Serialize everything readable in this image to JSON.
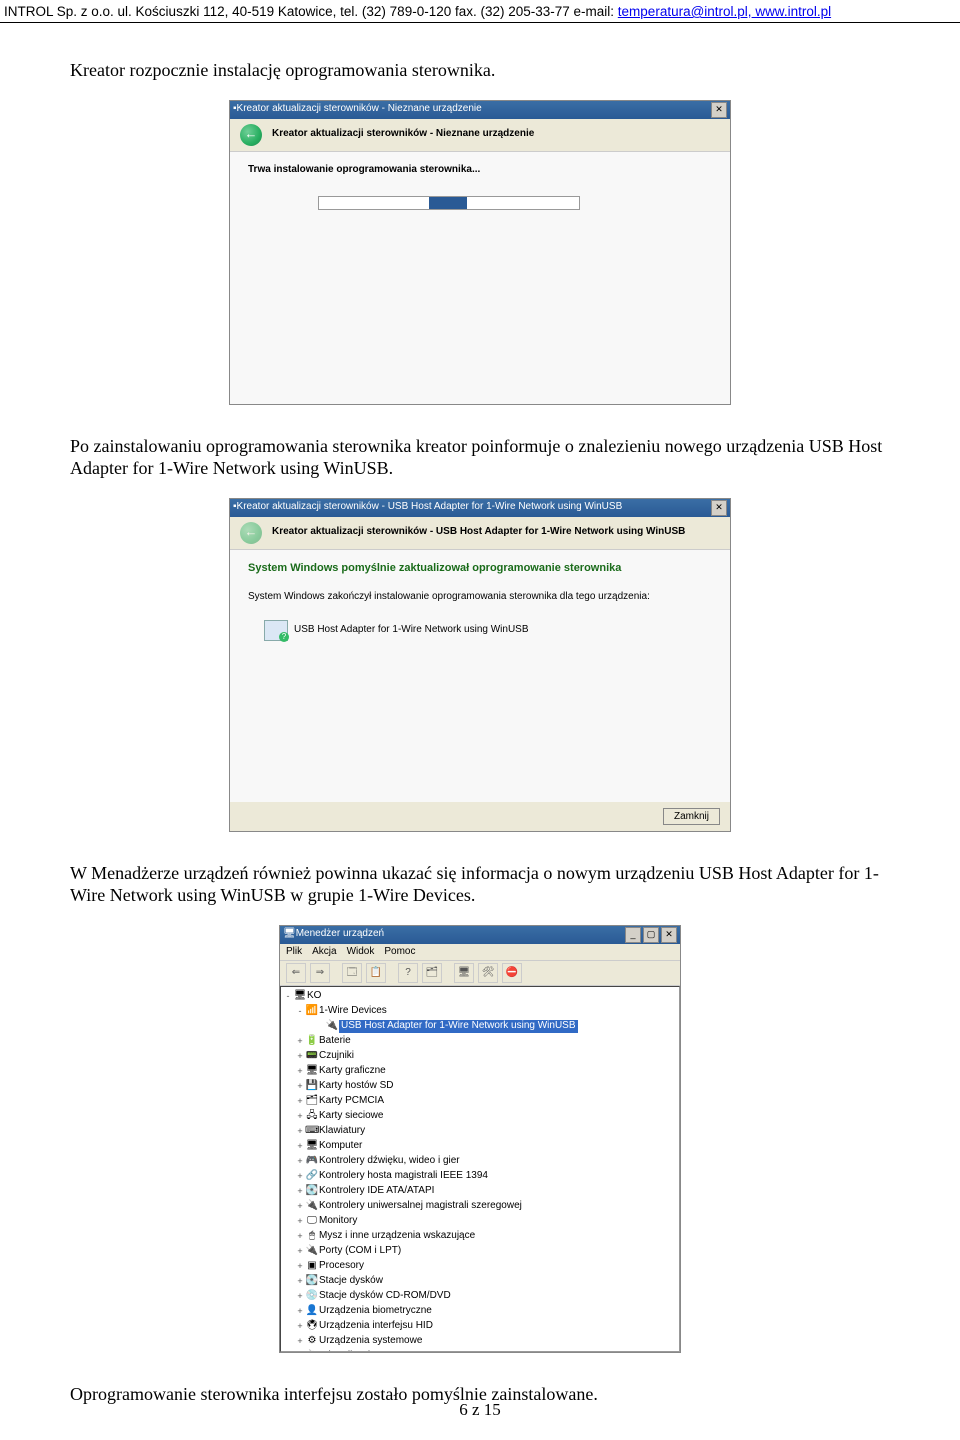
{
  "header": {
    "text_prefix": "INTROL Sp. z o.o. ul. Kościuszki 112, 40-519 Katowice, tel. (32) 789-0-120 fax. (32) 205-33-77 e-mail: ",
    "email": "temperatura@introl.pl,",
    "url": " www.introl.pl"
  },
  "p1": "Kreator rozpocznie instalację oprogramowania sterownika.",
  "shot1": {
    "title": "Kreator aktualizacji sterowników - Nieznane urządzenie",
    "subtitle": "Kreator aktualizacji sterowników - Nieznane urządzenie",
    "msg": "Trwa instalowanie oprogramowania sterownika..."
  },
  "p2": "Po zainstalowaniu oprogramowania sterownika kreator poinformuje o znalezieniu nowego urządzenia USB Host Adapter for 1-Wire Network using WinUSB.",
  "shot2": {
    "title": "Kreator aktualizacji sterowników - USB Host Adapter for 1-Wire Network using WinUSB",
    "subtitle": "Kreator aktualizacji sterowników - USB Host Adapter for 1-Wire Network using WinUSB",
    "h": "System Windows pomyślnie zaktualizował oprogramowanie sterownika",
    "msg": "System Windows zakończył instalowanie oprogramowania sterownika dla tego urządzenia:",
    "dev": "USB Host Adapter for 1-Wire Network using WinUSB",
    "close": "Zamknij"
  },
  "p3": "W Menadżerze urządzeń również powinna ukazać się informacja o nowym urządzeniu USB Host Adapter for 1-Wire Network using WinUSB w grupie 1-Wire Devices.",
  "shot3": {
    "title": "Menedżer urządzeń",
    "menu": [
      "Plik",
      "Akcja",
      "Widok",
      "Pomoc"
    ],
    "root": "KO",
    "items": [
      {
        "l": "1-Wire Devices",
        "exp": "-",
        "ic": "📶"
      },
      {
        "l": "USB Host Adapter for 1-Wire Network using WinUSB",
        "sel": true,
        "indent": 1,
        "ic": "🔌"
      },
      {
        "l": "Baterie",
        "exp": "+",
        "ic": "🔋"
      },
      {
        "l": "Czujniki",
        "exp": "+",
        "ic": "📟"
      },
      {
        "l": "Karty graficzne",
        "exp": "+",
        "ic": "🖥"
      },
      {
        "l": "Karty hostów SD",
        "exp": "+",
        "ic": "💾"
      },
      {
        "l": "Karty PCMCIA",
        "exp": "+",
        "ic": "🗂"
      },
      {
        "l": "Karty sieciowe",
        "exp": "+",
        "ic": "🖧"
      },
      {
        "l": "Klawiatury",
        "exp": "+",
        "ic": "⌨"
      },
      {
        "l": "Komputer",
        "exp": "+",
        "ic": "🖥"
      },
      {
        "l": "Kontrolery dźwięku, wideo i gier",
        "exp": "+",
        "ic": "🎮"
      },
      {
        "l": "Kontrolery hosta magistrali IEEE 1394",
        "exp": "+",
        "ic": "🔗"
      },
      {
        "l": "Kontrolery IDE ATA/ATAPI",
        "exp": "+",
        "ic": "💽"
      },
      {
        "l": "Kontrolery uniwersalnej magistrali szeregowej",
        "exp": "+",
        "ic": "🔌"
      },
      {
        "l": "Monitory",
        "exp": "+",
        "ic": "🖵"
      },
      {
        "l": "Mysz i inne urządzenia wskazujące",
        "exp": "+",
        "ic": "🖱"
      },
      {
        "l": "Porty (COM i LPT)",
        "exp": "+",
        "ic": "🔌"
      },
      {
        "l": "Procesory",
        "exp": "+",
        "ic": "▣"
      },
      {
        "l": "Stacje dysków",
        "exp": "+",
        "ic": "💽"
      },
      {
        "l": "Stacje dysków CD-ROM/DVD",
        "exp": "+",
        "ic": "💿"
      },
      {
        "l": "Urządzenia biometryczne",
        "exp": "+",
        "ic": "👤"
      },
      {
        "l": "Urządzenia interfejsu HID",
        "exp": "+",
        "ic": "🖲"
      },
      {
        "l": "Urządzenia systemowe",
        "exp": "+",
        "ic": "⚙"
      },
      {
        "l": "Wirtualizacja USB",
        "exp": "+",
        "ic": "🔌"
      }
    ]
  },
  "p4": "Oprogramowanie sterownika interfejsu zostało pomyślnie zainstalowane.",
  "footer": "6 z 15"
}
